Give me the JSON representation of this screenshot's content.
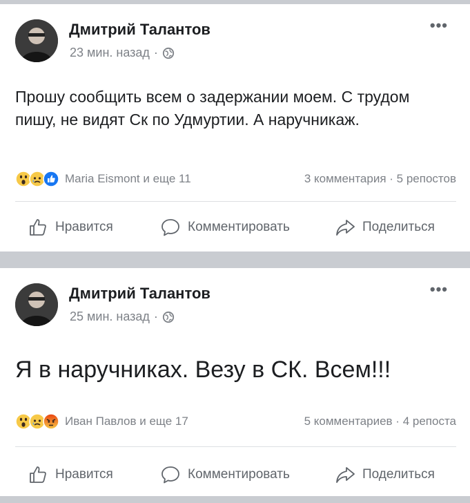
{
  "colors": {
    "separator": "#c9ccd1",
    "card": "#ffffff",
    "primary_text": "#1c1e21",
    "secondary_text": "#7d8187",
    "like_blue": "#1877f2",
    "sad_yellow": "#f7c948",
    "angry_red": "#e9710f"
  },
  "posts": [
    {
      "author": "Дмитрий Талантов",
      "time": "23 мин. назад",
      "dot": "·",
      "privacy_icon": "globe-icon",
      "more": "•••",
      "text": "Прошу сообщить всем о задержании моем. С трудом пишу, не видят Ск по Удмуртии. А наручникаж.",
      "reactions": [
        "wow",
        "sad",
        "like"
      ],
      "reacted_by": "Maria Eismont и еще 11",
      "comments": "3 комментария",
      "shares": "5 репостов",
      "actions": {
        "like": "Нравится",
        "comment": "Комментировать",
        "share": "Поделиться"
      }
    },
    {
      "author": "Дмитрий Талантов",
      "time": "25 мин. назад",
      "dot": "·",
      "privacy_icon": "globe-icon",
      "more": "•••",
      "text": "Я в наручниках. Везу в СК. Всем!!!",
      "reactions": [
        "wow",
        "sad",
        "angry"
      ],
      "reacted_by": "Иван Павлов и еще 17",
      "comments": "5 комментариев",
      "shares": "4 репоста",
      "actions": {
        "like": "Нравится",
        "comment": "Комментировать",
        "share": "Поделиться"
      }
    }
  ]
}
